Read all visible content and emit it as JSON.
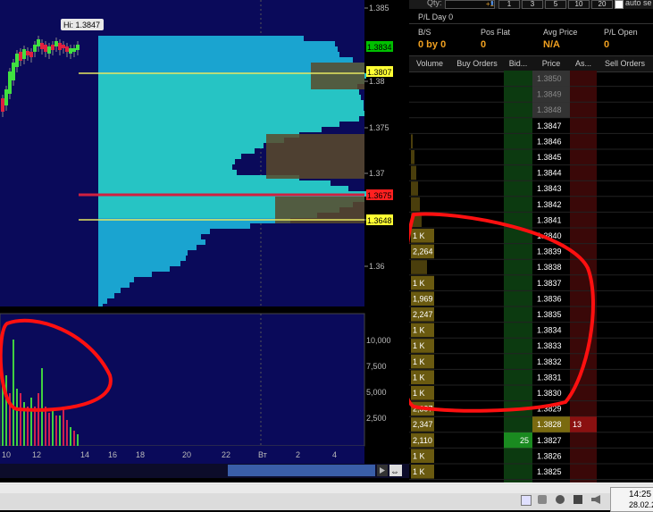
{
  "chart": {
    "hi_label": "Hi: 1.3847",
    "price_axis_ticks": [
      "1.385",
      "1.38",
      "1.375",
      "1.37",
      "1.365",
      "1.36"
    ],
    "price_badges": [
      {
        "text": "1.3834",
        "color": "#00c000"
      },
      {
        "text": "1.3807",
        "color": "#ffff33"
      },
      {
        "text": "1.3675",
        "color": "#ff2020"
      },
      {
        "text": "1.3648",
        "color": "#ffff33"
      }
    ],
    "volume_axis_ticks": [
      "10,000",
      "7,500",
      "5,000",
      "2,500"
    ],
    "time_axis_ticks": [
      "10",
      "12",
      "14",
      "16",
      "18",
      "20",
      "22",
      "Вт",
      "2",
      "4"
    ]
  },
  "ladder": {
    "toolbar": {
      "qty_label": "Qty:",
      "qty_value": "+1",
      "qty_buttons": [
        "1",
        "3",
        "5",
        "10",
        "20"
      ],
      "auto_label": "auto se"
    },
    "pl_day": "P/L Day 0",
    "stats": [
      {
        "label": "B/S",
        "value": "0 by 0"
      },
      {
        "label": "Pos Flat",
        "value": "0"
      },
      {
        "label": "Avg Price",
        "value": "N/A"
      },
      {
        "label": "P/L Open",
        "value": "0"
      }
    ],
    "columns": [
      "Volume",
      "Buy Orders",
      "Bid...",
      "Price",
      "As...",
      "Sell Orders"
    ],
    "rows": [
      {
        "price": "1.3850",
        "volume": "",
        "bid": "",
        "ask": "",
        "dim": true
      },
      {
        "price": "1.3849",
        "volume": "",
        "bid": "",
        "ask": "",
        "dim": true
      },
      {
        "price": "1.3848",
        "volume": "",
        "bid": "",
        "ask": "",
        "dim": true
      },
      {
        "price": "1.3847",
        "volume": "",
        "bid": "",
        "ask": ""
      },
      {
        "price": "1.3846",
        "volume": "",
        "bid": "",
        "ask": ""
      },
      {
        "price": "1.3845",
        "volume": "",
        "bid": "",
        "ask": ""
      },
      {
        "price": "1.3844",
        "volume": "",
        "bid": "",
        "ask": ""
      },
      {
        "price": "1.3843",
        "volume": "",
        "bid": "",
        "ask": ""
      },
      {
        "price": "1.3842",
        "volume": "",
        "bid": "",
        "ask": ""
      },
      {
        "price": "1.3841",
        "volume": "",
        "bid": "",
        "ask": ""
      },
      {
        "price": "1.3840",
        "volume": "1 K",
        "bid": "",
        "ask": ""
      },
      {
        "price": "1.3839",
        "volume": "2,264",
        "bid": "",
        "ask": ""
      },
      {
        "price": "1.3838",
        "volume": "",
        "bid": "",
        "ask": ""
      },
      {
        "price": "1.3837",
        "volume": "1 K",
        "bid": "",
        "ask": ""
      },
      {
        "price": "1.3836",
        "volume": "1,969",
        "bid": "",
        "ask": ""
      },
      {
        "price": "1.3835",
        "volume": "2,247",
        "bid": "",
        "ask": ""
      },
      {
        "price": "1.3834",
        "volume": "1 K",
        "bid": "",
        "ask": ""
      },
      {
        "price": "1.3833",
        "volume": "1 K",
        "bid": "",
        "ask": ""
      },
      {
        "price": "1.3832",
        "volume": "1 K",
        "bid": "",
        "ask": ""
      },
      {
        "price": "1.3831",
        "volume": "1 K",
        "bid": "",
        "ask": ""
      },
      {
        "price": "1.3830",
        "volume": "1 K",
        "bid": "",
        "ask": ""
      },
      {
        "price": "1.3829",
        "volume": "2,397",
        "bid": "",
        "ask": ""
      },
      {
        "price": "1.3828",
        "volume": "2,347",
        "bid": "",
        "ask": "13",
        "hl": true
      },
      {
        "price": "1.3827",
        "volume": "2,110",
        "bid": "25",
        "ask": ""
      },
      {
        "price": "1.3826",
        "volume": "1 K",
        "bid": "",
        "ask": ""
      },
      {
        "price": "1.3825",
        "volume": "1 K",
        "bid": "",
        "ask": ""
      }
    ]
  },
  "taskbar": {
    "clock": "14:25",
    "date": "28.02.20"
  }
}
